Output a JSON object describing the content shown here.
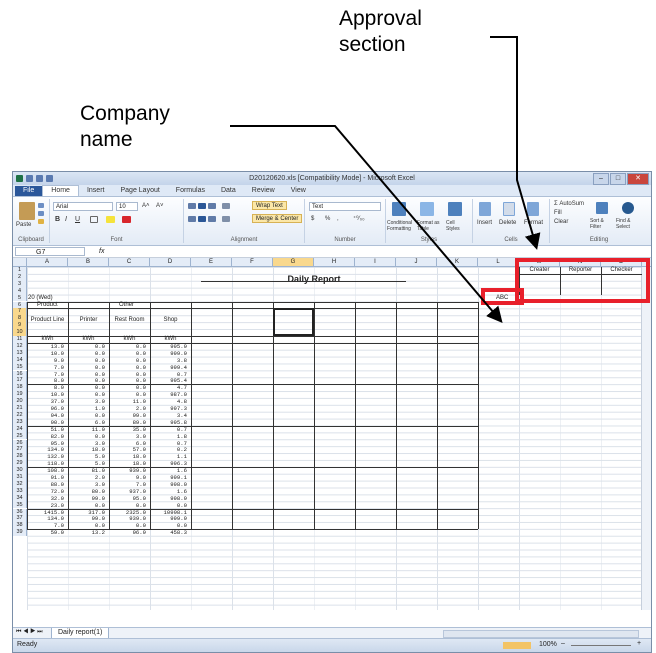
{
  "annotations": {
    "approval_line1": "Approval",
    "approval_line2": "section",
    "company_line1": "Company",
    "company_line2": "name"
  },
  "window": {
    "title": "D20120620.xls  [Compatibility Mode]  -  Microsoft Excel",
    "min": "–",
    "max": "□",
    "close": "✕"
  },
  "tabs": [
    "File",
    "Home",
    "Insert",
    "Page Layout",
    "Formulas",
    "Data",
    "Review",
    "View"
  ],
  "ribbon": {
    "clipboard": {
      "paste": "Paste",
      "label": "Clipboard"
    },
    "font": {
      "name": "Arial",
      "size": "10",
      "bold": "B",
      "italic": "I",
      "underline": "U",
      "grow": "A˄",
      "shrink": "A˅",
      "label": "Font"
    },
    "alignment": {
      "wrap": "Wrap Text",
      "merge": "Merge & Center",
      "label": "Alignment"
    },
    "number": {
      "format": "Text",
      "currency": "$",
      "percent": "%",
      "comma": ",",
      "incdec": "⁺⁰⁄₀₀",
      "label": "Number"
    },
    "styles": {
      "conditional": "Conditional Formatting",
      "format_table": "Format as Table",
      "cell_styles": "Cell Styles",
      "label": "Styles"
    },
    "cells": {
      "insert": "Insert",
      "delete": "Delete",
      "format": "Format",
      "label": "Cells"
    },
    "editing": {
      "autosum": "Σ AutoSum",
      "fill": "Fill",
      "clear": "Clear",
      "sort": "Sort & Filter",
      "find": "Find & Select",
      "label": "Editing"
    }
  },
  "formula_bar": {
    "name_box": "G7",
    "fx": "fx",
    "value": ""
  },
  "columns": [
    "A",
    "B",
    "C",
    "D",
    "E",
    "F",
    "G",
    "H",
    "I",
    "J",
    "K",
    "L",
    "M",
    "N",
    "O",
    "P"
  ],
  "sheet": {
    "title": "Daily Report",
    "date": "20 (Wed)",
    "company_abbr": "ABC",
    "approval": [
      "Creater",
      "Reporter",
      "Checker"
    ],
    "group_product": "Product",
    "group_other": "Other",
    "headers": [
      "Product Line",
      "Printer",
      "Rest Room",
      "Shop"
    ],
    "units": [
      "kWh",
      "kWh",
      "kWh",
      "kWh"
    ],
    "row_numbers": [
      "1",
      "2",
      "3",
      "4",
      "5",
      "6",
      "7",
      "8",
      "9",
      "10",
      "11",
      "12",
      "13",
      "14",
      "15",
      "16",
      "17",
      "18",
      "19",
      "20",
      "21",
      "22",
      "23",
      "24",
      "25",
      "26",
      "27",
      "28",
      "29",
      "30",
      "31",
      "32",
      "33",
      "34",
      "35",
      "36",
      "37",
      "38",
      "39"
    ],
    "rows": [
      [
        "13.0",
        "0.0",
        "0.0",
        "995.9"
      ],
      [
        "10.0",
        "0.0",
        "0.0",
        "999.9"
      ],
      [
        "9.0",
        "0.0",
        "0.0",
        "3.8"
      ],
      [
        "7.0",
        "0.0",
        "0.0",
        "999.4"
      ],
      [
        "7.0",
        "0.0",
        "0.0",
        "0.7"
      ],
      [
        "8.0",
        "0.0",
        "0.0",
        "995.4"
      ],
      [
        "8.0",
        "0.0",
        "0.0",
        "4.7"
      ],
      [
        "10.0",
        "0.0",
        "0.0",
        "987.0"
      ],
      [
        "37.0",
        "3.0",
        "11.0",
        "4.8"
      ],
      [
        "96.0",
        "1.0",
        "2.0",
        "997.3"
      ],
      [
        "94.0",
        "0.0",
        "99.0",
        "3.4"
      ],
      [
        "90.0",
        "6.0",
        "89.0",
        "995.8"
      ],
      [
        "51.0",
        "11.0",
        "35.0",
        "0.7"
      ],
      [
        "82.0",
        "0.0",
        "3.0",
        "1.8"
      ],
      [
        "95.0",
        "3.0",
        "6.0",
        "0.7"
      ],
      [
        "134.0",
        "18.0",
        "57.0",
        "0.2"
      ],
      [
        "132.0",
        "5.0",
        "18.0",
        "1.1"
      ],
      [
        "118.0",
        "5.0",
        "18.0",
        "996.3"
      ],
      [
        "108.0",
        "81.0",
        "939.0",
        "1.6"
      ],
      [
        "91.0",
        "2.0",
        "9.0",
        "999.1"
      ],
      [
        "88.0",
        "3.0",
        "7.0",
        "998.0"
      ],
      [
        "72.0",
        "80.0",
        "937.0",
        "1.6"
      ],
      [
        "32.0",
        "99.0",
        "95.0",
        "998.9"
      ],
      [
        "23.0",
        "0.0",
        "0.0",
        "0.0"
      ],
      [
        "1415.0",
        "317.0",
        "2325.0",
        "10998.1"
      ],
      [
        "134.0",
        "99.0",
        "939.0",
        "999.9"
      ],
      [
        "7.0",
        "0.0",
        "0.0",
        "0.0"
      ],
      [
        "59.0",
        "13.2",
        "96.9",
        "458.3"
      ]
    ]
  },
  "sheet_tab": "Daily report(1)",
  "status": {
    "ready": "Ready",
    "zoom": "100%",
    "minus": "–",
    "plus": "+"
  }
}
